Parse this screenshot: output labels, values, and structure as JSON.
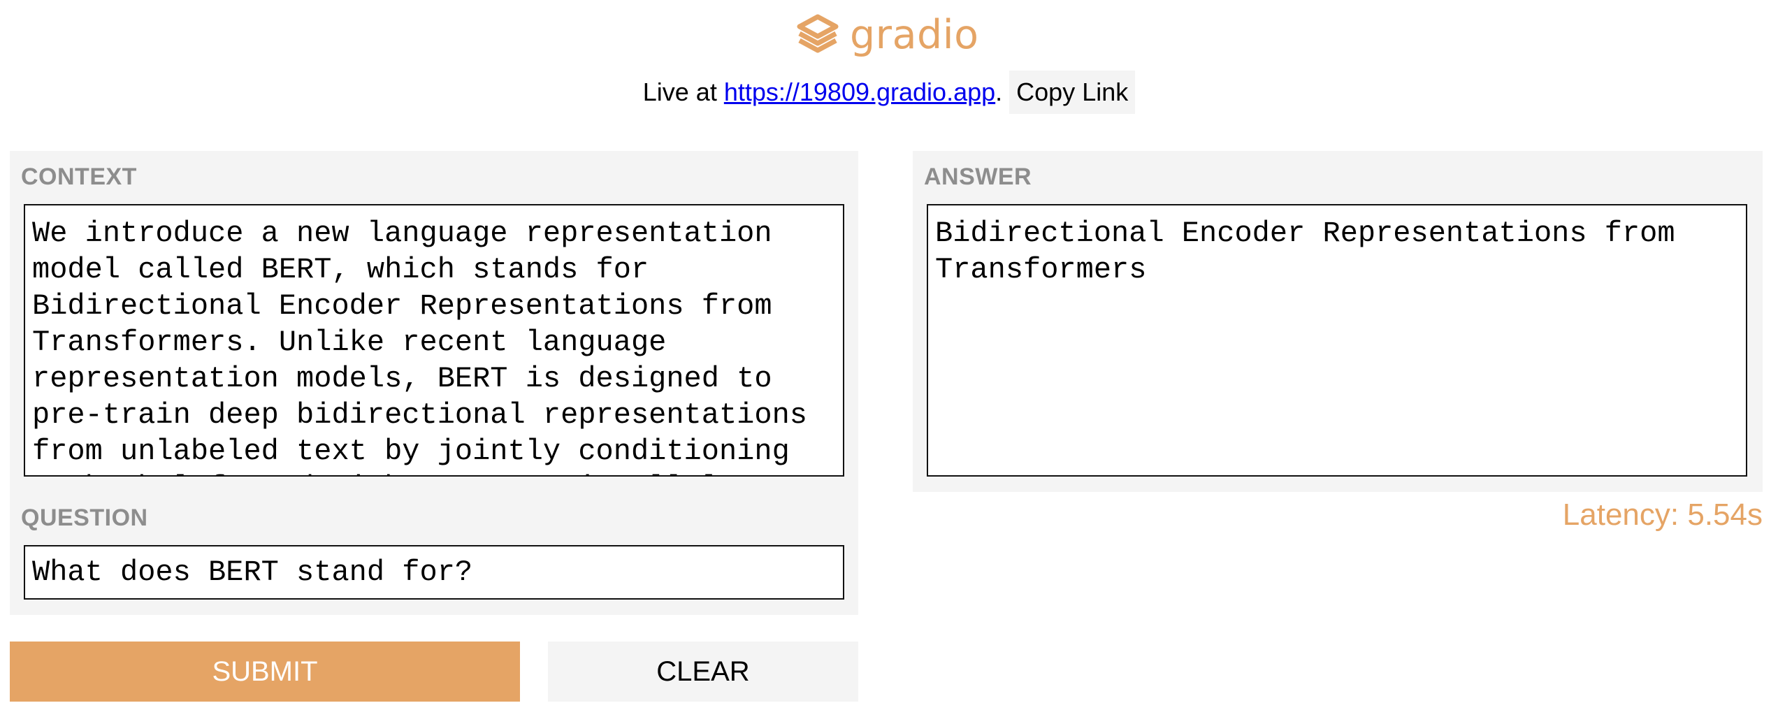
{
  "brand": {
    "name": "gradio",
    "icon": "gradio-logo-icon",
    "color": "#e5a465"
  },
  "share": {
    "prefix": "Live at ",
    "url": "https://19809.gradio.app",
    "suffix": ".",
    "copy_label": "Copy Link"
  },
  "inputs": {
    "context": {
      "label": "CONTEXT",
      "value": "We introduce a new language representation model called BERT, which stands for Bidirectional Encoder Representations from Transformers. Unlike recent language representation models, BERT is designed to pre-train deep bidirectional representations from unlabeled text by jointly conditioning on both left and right context in all layers."
    },
    "question": {
      "label": "QUESTION",
      "value": "What does BERT stand for?"
    }
  },
  "output": {
    "label": "ANSWER",
    "value": "Bidirectional Encoder Representations from Transformers"
  },
  "actions": {
    "submit_label": "SUBMIT",
    "clear_label": "CLEAR"
  },
  "latency": "Latency: 5.54s",
  "colors": {
    "accent": "#e5a465",
    "panel_bg": "#f4f4f4",
    "label_gray": "#8d8d8d"
  }
}
